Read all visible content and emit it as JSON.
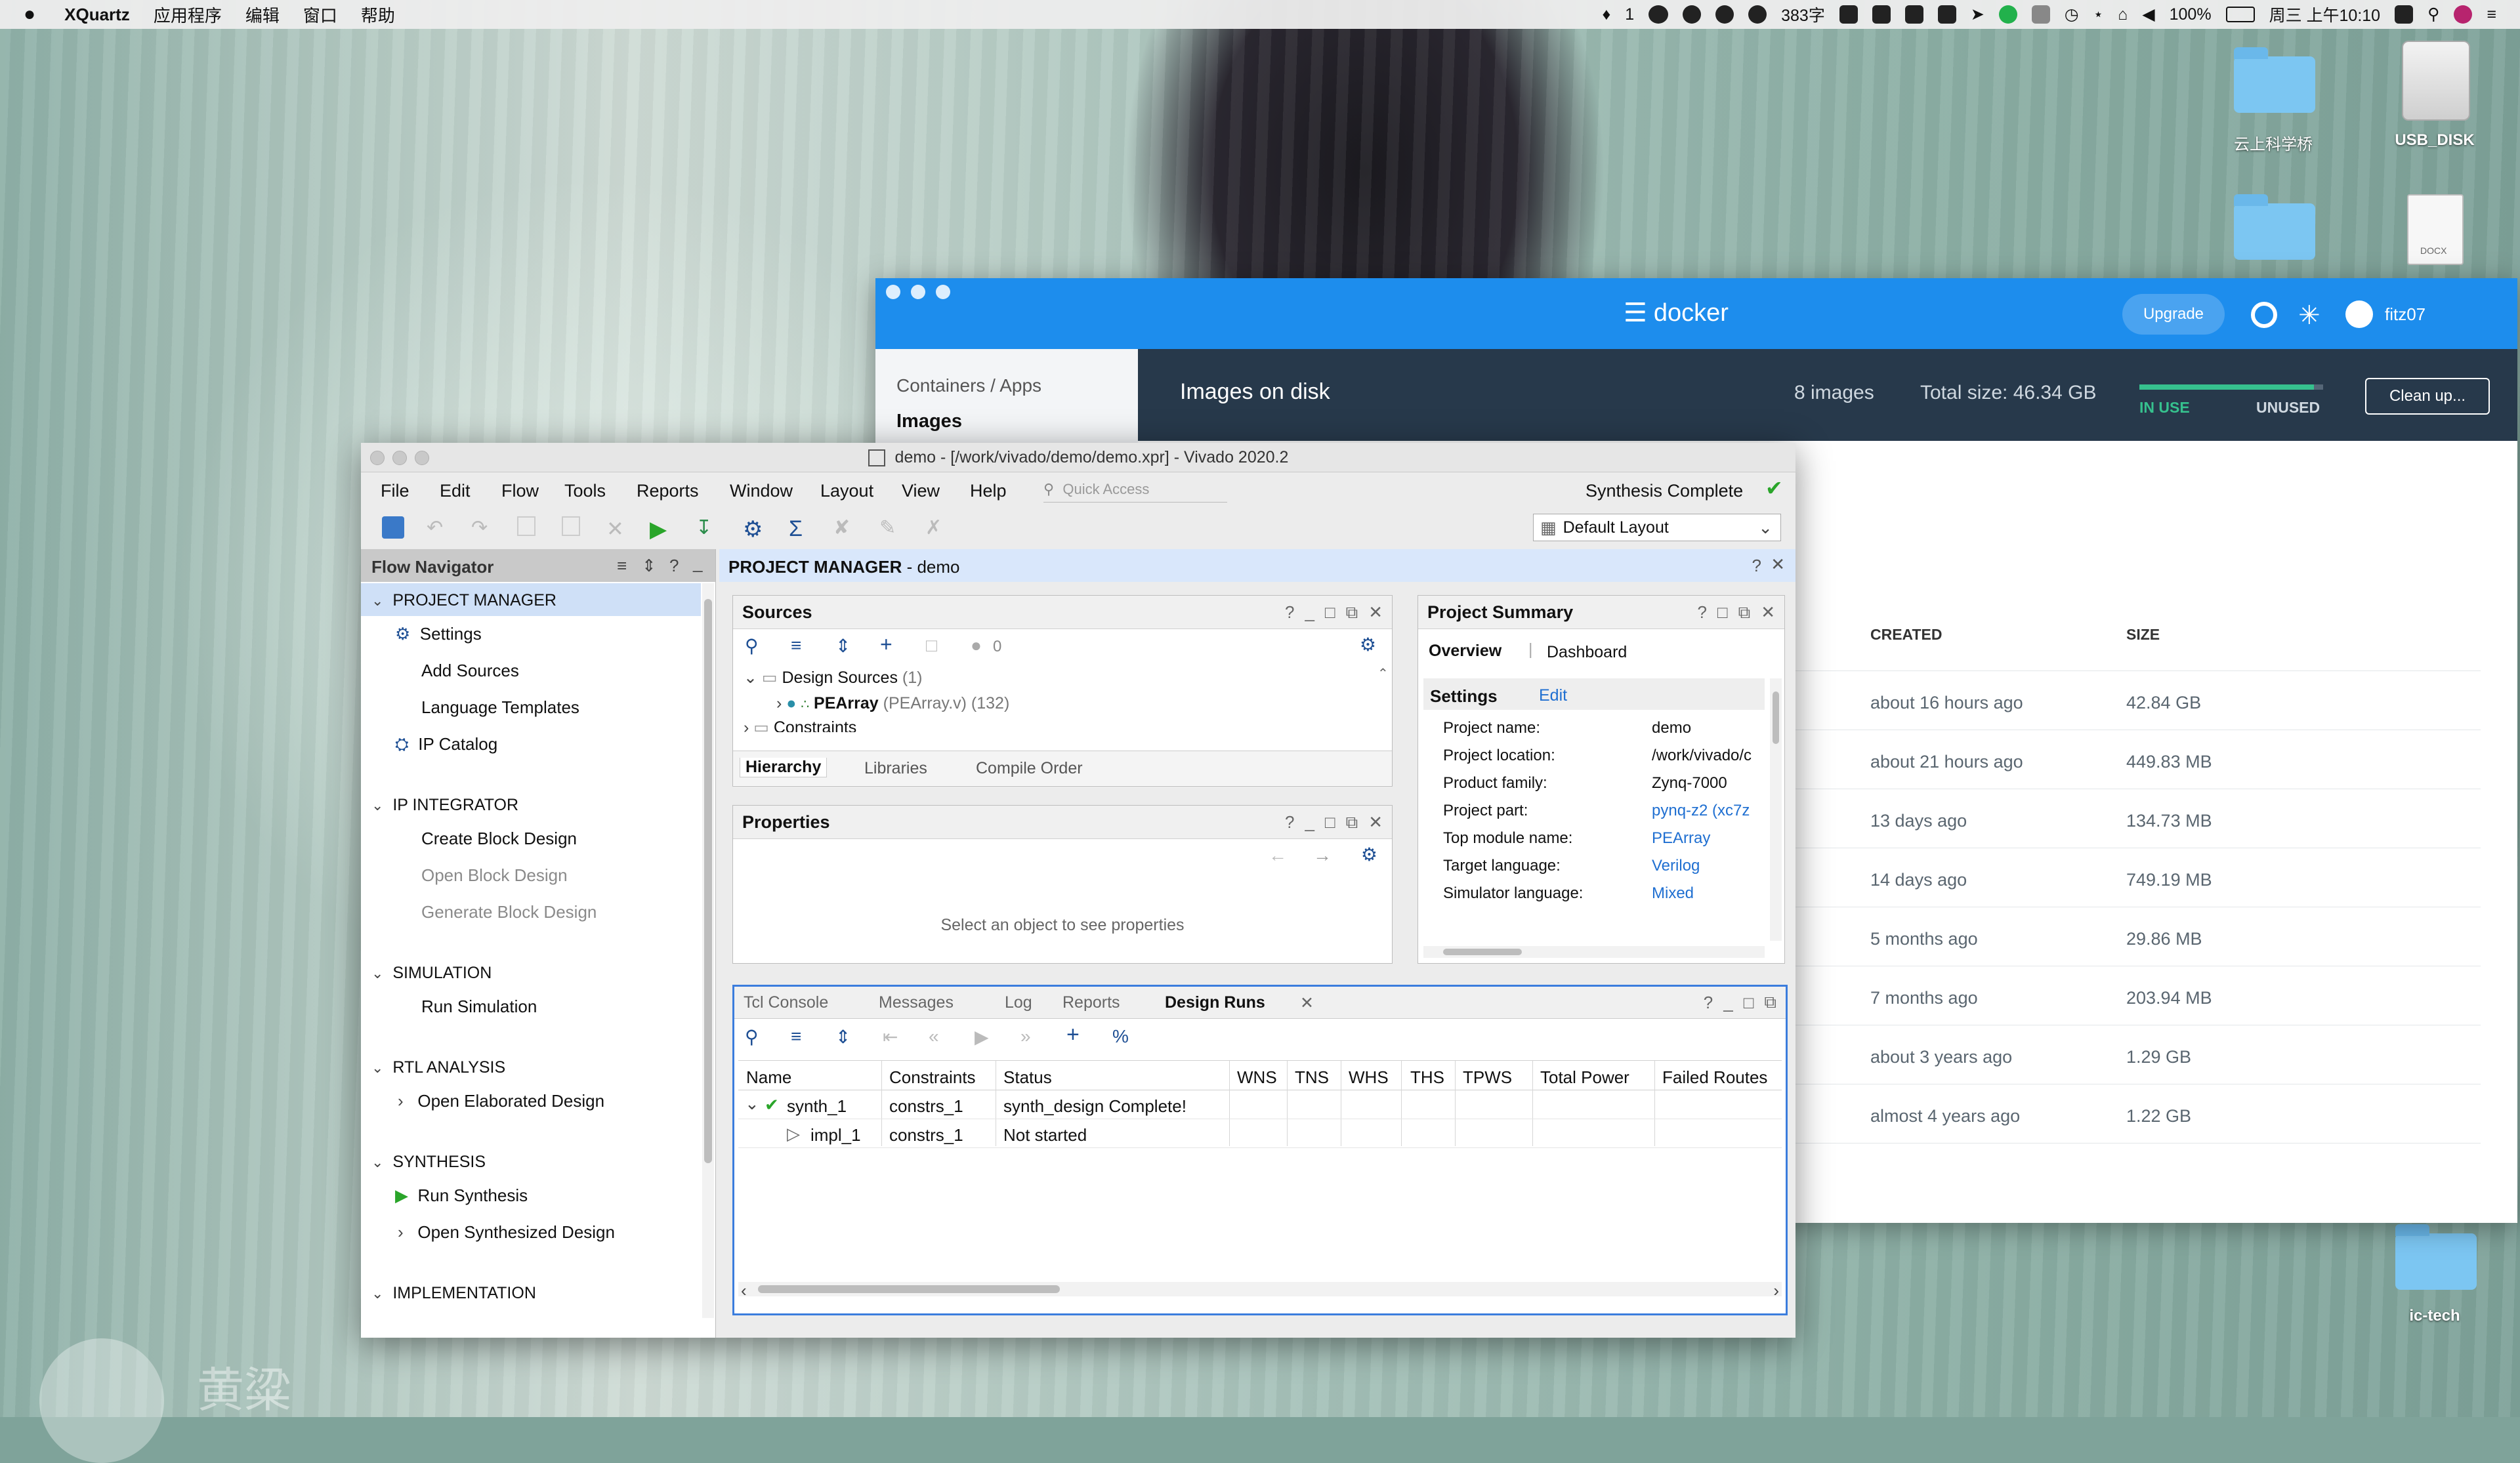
{
  "menubar": {
    "app_name": "XQuartz",
    "menus": [
      "应用程序",
      "编辑",
      "窗口",
      "帮助"
    ],
    "status": {
      "notif_count": "1",
      "count_383": "383字",
      "battery": "100%",
      "datetime": "周三 上午10:10"
    }
  },
  "desktop": {
    "icons": [
      {
        "label": "云上科学桥"
      },
      {
        "label": "USB_DISK"
      },
      {
        "label": ""
      },
      {
        "label": "DOCX"
      },
      {
        "label": "ic-tech"
      }
    ],
    "watermark": "黄粱"
  },
  "docker": {
    "logo": "docker",
    "upgrade": "Upgrade",
    "user": "fitz07",
    "nav": {
      "containers": "Containers / Apps",
      "images": "Images"
    },
    "header": {
      "title": "Images on disk",
      "count": "8 images",
      "total": "Total size: 46.34 GB",
      "in_use": "IN USE",
      "unused": "UNUSED",
      "cleanup": "Clean up...",
      "usage_fraction": 0.95
    },
    "columns": {
      "created": "CREATED",
      "size": "SIZE"
    },
    "rows": [
      {
        "created": "about 16 hours ago",
        "size": "42.84 GB"
      },
      {
        "created": "about 21 hours ago",
        "size": "449.83 MB"
      },
      {
        "created": "13 days ago",
        "size": "134.73 MB"
      },
      {
        "created": "14 days ago",
        "size": "749.19 MB"
      },
      {
        "created": "5 months ago",
        "size": "29.86 MB"
      },
      {
        "created": "7 months ago",
        "size": "203.94 MB"
      },
      {
        "created": "about 3 years ago",
        "size": "1.29 GB"
      },
      {
        "created": "almost 4 years ago",
        "size": "1.22 GB"
      }
    ]
  },
  "vivado": {
    "title": "demo - [/work/vivado/demo/demo.xpr] - Vivado 2020.2",
    "menus": [
      "File",
      "Edit",
      "Flow",
      "Tools",
      "Reports",
      "Window",
      "Layout",
      "View",
      "Help"
    ],
    "quick_access": "Quick Access",
    "status": "Synthesis Complete",
    "layout_select": "Default Layout",
    "flow_nav": {
      "title": "Flow Navigator",
      "sections": [
        {
          "name": "PROJECT MANAGER",
          "items": [
            "Settings",
            "Add Sources",
            "Language Templates",
            "IP Catalog"
          ]
        },
        {
          "name": "IP INTEGRATOR",
          "items": [
            "Create Block Design",
            "Open Block Design",
            "Generate Block Design"
          ]
        },
        {
          "name": "SIMULATION",
          "items": [
            "Run Simulation"
          ]
        },
        {
          "name": "RTL ANALYSIS",
          "items": [
            "Open Elaborated Design"
          ]
        },
        {
          "name": "SYNTHESIS",
          "items": [
            "Run Synthesis",
            "Open Synthesized Design"
          ]
        },
        {
          "name": "IMPLEMENTATION",
          "items": []
        }
      ]
    },
    "pm_header": {
      "title": "PROJECT MANAGER",
      "suffix": " - demo"
    },
    "sources": {
      "title": "Sources",
      "badge": "0",
      "tree": {
        "design_sources": "Design Sources",
        "design_count": "(1)",
        "top": "PEArray",
        "top_file": "(PEArray.v) (132)",
        "constraints": "Constraints"
      },
      "tabs": [
        "Hierarchy",
        "Libraries",
        "Compile Order"
      ]
    },
    "properties": {
      "title": "Properties",
      "empty": "Select an object to see properties"
    },
    "summary": {
      "title": "Project Summary",
      "tabs": [
        "Overview",
        "Dashboard"
      ],
      "settings": "Settings",
      "edit": "Edit",
      "fields": [
        {
          "label": "Project name:",
          "value": "demo"
        },
        {
          "label": "Project location:",
          "value": "/work/vivado/c"
        },
        {
          "label": "Product family:",
          "value": "Zynq-7000"
        },
        {
          "label": "Project part:",
          "value": "pynq-z2 (xc7z"
        },
        {
          "label": "Top module name:",
          "value": "PEArray"
        },
        {
          "label": "Target language:",
          "value": "Verilog"
        },
        {
          "label": "Simulator language:",
          "value": "Mixed"
        }
      ]
    },
    "runs": {
      "tabs": [
        "Tcl Console",
        "Messages",
        "Log",
        "Reports",
        "Design Runs"
      ],
      "columns": [
        "Name",
        "Constraints",
        "Status",
        "WNS",
        "TNS",
        "WHS",
        "THS",
        "TPWS",
        "Total Power",
        "Failed Routes"
      ],
      "rows": [
        {
          "name": "synth_1",
          "constraints": "constrs_1",
          "status": "synth_design Complete!"
        },
        {
          "name": "impl_1",
          "constraints": "constrs_1",
          "status": "Not started"
        }
      ]
    }
  }
}
